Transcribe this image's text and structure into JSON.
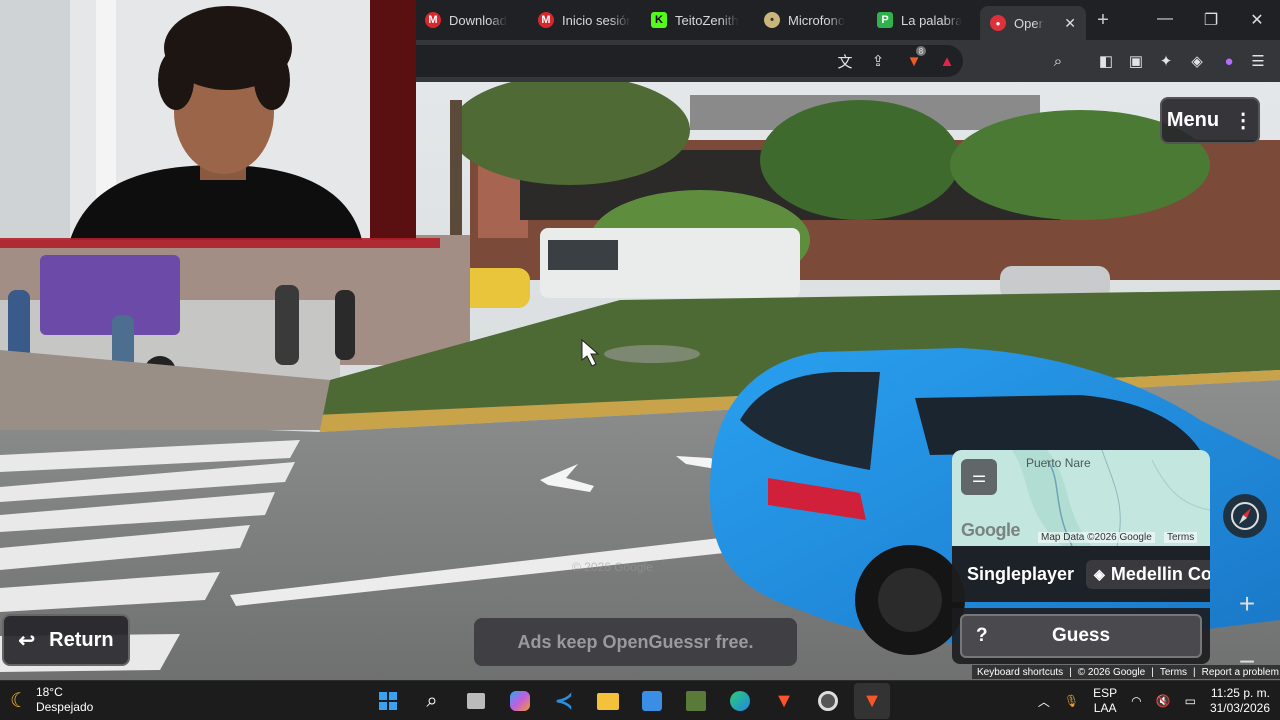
{
  "browser": {
    "tabs": [
      {
        "label": "Download",
        "icon": "mega-icon",
        "color": "#d9272e",
        "glyph": "M"
      },
      {
        "label": "Inicio sesión",
        "icon": "mega-icon",
        "color": "#d9272e",
        "glyph": "M"
      },
      {
        "label": "TeitoZenith",
        "icon": "kick-icon",
        "color": "#53fc18",
        "glyph": "K"
      },
      {
        "label": "Microfono",
        "icon": "microphone-site-icon",
        "color": "#c8b67a",
        "glyph": "•"
      },
      {
        "label": "La palabra",
        "icon": "p-site-icon",
        "color": "#2fb24c",
        "glyph": "P"
      },
      {
        "label": "OpenGuessr",
        "icon": "openguessr-icon",
        "color": "#e0303a",
        "glyph": "●"
      }
    ],
    "new_tab_label": "+",
    "brave_shield_count": "8",
    "toolbar_icons": [
      "translate-icon",
      "share-icon",
      "brave-shield-icon",
      "brave-rewards-icon",
      "tab-search-icon",
      "sidebar-icon",
      "wallet-icon",
      "leo-ai-icon",
      "vpn-icon",
      "profile-icon",
      "app-menu-icon"
    ]
  },
  "game": {
    "menu_label": "Menu",
    "return_label": "Return",
    "ads_text": "Ads keep OpenGuessr free.",
    "minimap": {
      "place": "Puerto Nare",
      "logo": "Google",
      "attribution": "Map Data ©2026 Google",
      "terms": "Terms"
    },
    "mode_label": "Singleplayer",
    "location_label": "Medellin Colombia",
    "guess_label": "Guess",
    "guess_help": "?",
    "zoom_in": "+",
    "zoom_out": "−",
    "footer": {
      "shortcuts": "Keyboard shortcuts",
      "copyright": "© 2026 Google",
      "terms": "Terms",
      "report": "Report a problem"
    },
    "watermark": "© 2026 Google"
  },
  "taskbar": {
    "weather_temp": "18°C",
    "weather_desc": "Despejado",
    "apps": [
      "windows-start-icon",
      "search-icon",
      "task-view-icon",
      "copilot-icon",
      "vscode-icon",
      "file-explorer-icon",
      "microsoft-store-icon",
      "minecraft-icon",
      "edge-icon",
      "brave-icon",
      "chrome-icon",
      "brave-beta-icon"
    ],
    "lang_top": "ESP",
    "lang_bottom": "LAA",
    "time": "11:25 p. m.",
    "date": "31/03/2026"
  },
  "colors": {
    "car_blue": "#1f8fe0",
    "accent_red": "#e0303a"
  }
}
